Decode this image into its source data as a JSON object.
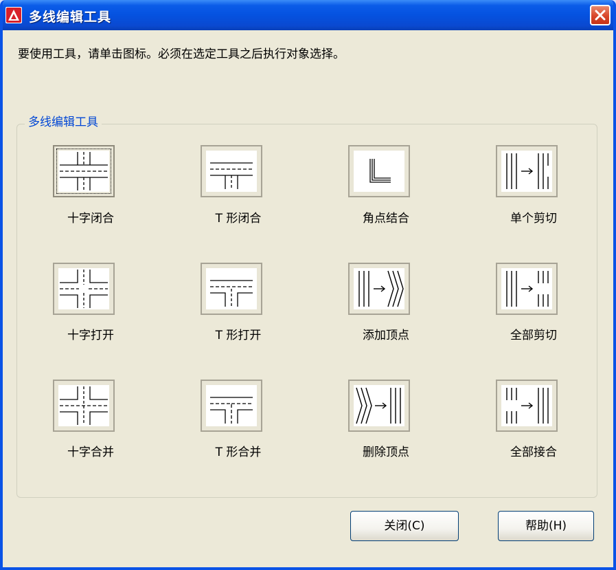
{
  "window": {
    "title": "多线编辑工具",
    "icon": "autocad-logo-icon",
    "close_icon": "close-icon",
    "close_color": "#d9472b"
  },
  "instruction": "要使用工具，请单击图标。必须在选定工具之后执行对象选择。",
  "group": {
    "title": "多线编辑工具",
    "tools": [
      {
        "label": "十字闭合",
        "icon": "cross-closed-icon",
        "selected": true
      },
      {
        "label": "T 形闭合",
        "icon": "tee-closed-icon"
      },
      {
        "label": "角点结合",
        "icon": "corner-joint-icon"
      },
      {
        "label": "单个剪切",
        "icon": "cut-single-icon"
      },
      {
        "label": "十字打开",
        "icon": "cross-open-icon"
      },
      {
        "label": "T 形打开",
        "icon": "tee-open-icon"
      },
      {
        "label": "添加顶点",
        "icon": "add-vertex-icon"
      },
      {
        "label": "全部剪切",
        "icon": "cut-all-icon"
      },
      {
        "label": "十字合并",
        "icon": "cross-merged-icon"
      },
      {
        "label": "T 形合并",
        "icon": "tee-merged-icon"
      },
      {
        "label": "删除顶点",
        "icon": "delete-vertex-icon"
      },
      {
        "label": "全部接合",
        "icon": "weld-all-icon"
      }
    ]
  },
  "buttons": {
    "close": "关闭(C)",
    "help": "帮助(H)"
  },
  "colors": {
    "titlebar": "#0552e0",
    "dialog_bg": "#ece9d8",
    "group_title": "#0046d5"
  }
}
